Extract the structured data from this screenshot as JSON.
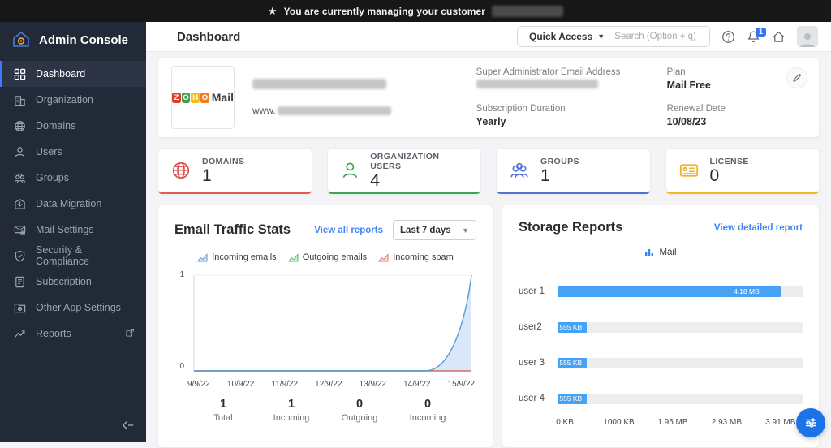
{
  "top_bar": {
    "message": "You are currently managing your customer"
  },
  "sidebar": {
    "app_title": "Admin Console",
    "items": [
      {
        "label": "Dashboard"
      },
      {
        "label": "Organization"
      },
      {
        "label": "Domains"
      },
      {
        "label": "Users"
      },
      {
        "label": "Groups"
      },
      {
        "label": "Data Migration"
      },
      {
        "label": "Mail Settings"
      },
      {
        "label": "Security & Compliance"
      },
      {
        "label": "Subscription"
      },
      {
        "label": "Other App Settings"
      },
      {
        "label": "Reports"
      }
    ]
  },
  "header": {
    "title": "Dashboard",
    "quick_access_label": "Quick Access",
    "search_placeholder": "Search (Option + q)",
    "notification_count": "1"
  },
  "org_card": {
    "logo_letters": [
      "Z",
      "O",
      "H",
      "O"
    ],
    "logo_letter_colors": [
      "#e23b2e",
      "#43a047",
      "#f4b921",
      "#ef7c24"
    ],
    "logo_mail_text": "Mail",
    "website_prefix": "www.",
    "fields": [
      {
        "label": "Super Administrator Email Address",
        "value": ""
      },
      {
        "label": "Plan",
        "value": "Mail Free"
      },
      {
        "label": "Subscription Duration",
        "value": "Yearly"
      },
      {
        "label": "Renewal Date",
        "value": "10/08/23"
      }
    ]
  },
  "stat_cards": [
    {
      "label": "DOMAINS",
      "value": "1",
      "accent": "#e05b55"
    },
    {
      "label": "ORGANIZATION USERS",
      "value": "4",
      "accent": "#3fa45b"
    },
    {
      "label": "GROUPS",
      "value": "1",
      "accent": "#5472d3"
    },
    {
      "label": "LICENSE",
      "value": "0",
      "accent": "#f2b824"
    }
  ],
  "email_traffic": {
    "title": "Email Traffic Stats",
    "link": "View all reports",
    "range": "Last 7 days",
    "y_ticks": [
      "1",
      "0"
    ],
    "summary": [
      {
        "value": "1",
        "label": "Total"
      },
      {
        "value": "1",
        "label": "Incoming"
      },
      {
        "value": "0",
        "label": "Outgoing"
      },
      {
        "value": "0",
        "label": "Incoming"
      }
    ]
  },
  "storage": {
    "title": "Storage Reports",
    "link": "View detailed report",
    "legend": "Mail",
    "rows": [
      {
        "label": "user 1",
        "value": "4.18 MB",
        "pct": 91
      },
      {
        "label": "user2",
        "value": "555 KB",
        "pct": 12
      },
      {
        "label": "user 3",
        "value": "555 KB",
        "pct": 12
      },
      {
        "label": "user 4",
        "value": "555 KB",
        "pct": 12
      }
    ],
    "axis": [
      "0 KB",
      "1000 KB",
      "1.95 MB",
      "2.93 MB",
      "3.91 MB"
    ]
  },
  "chart_data": [
    {
      "type": "area",
      "title": "Email Traffic Stats",
      "x": [
        "9/9/22",
        "10/9/22",
        "11/9/22",
        "12/9/22",
        "13/9/22",
        "14/9/22",
        "15/9/22"
      ],
      "series": [
        {
          "name": "Incoming emails",
          "color": "#5b9bd5",
          "fill": "#d9e7f8",
          "values": [
            0,
            0,
            0,
            0,
            0,
            0,
            1
          ]
        },
        {
          "name": "Outgoing emails",
          "color": "#67b56f",
          "fill": "none",
          "values": [
            0,
            0,
            0,
            0,
            0,
            0,
            0
          ]
        },
        {
          "name": "Incoming spam",
          "color": "#e07a72",
          "fill": "none",
          "values": [
            0,
            0,
            0,
            0,
            0,
            0,
            0
          ]
        }
      ],
      "ylim": [
        0,
        1
      ],
      "legend_position": "top",
      "grid": false
    },
    {
      "type": "bar",
      "orientation": "horizontal",
      "title": "Storage Reports",
      "series_name": "Mail",
      "categories": [
        "user 1",
        "user2",
        "user 3",
        "user 4"
      ],
      "values_kb": [
        4280,
        555,
        555,
        555
      ],
      "value_labels": [
        "4.18 MB",
        "555 KB",
        "555 KB",
        "555 KB"
      ],
      "x_ticks": [
        "0 KB",
        "1000 KB",
        "1.95 MB",
        "2.93 MB",
        "3.91 MB"
      ],
      "bar_color": "#45a2f4",
      "xlim_kb": [
        0,
        4700
      ]
    }
  ]
}
